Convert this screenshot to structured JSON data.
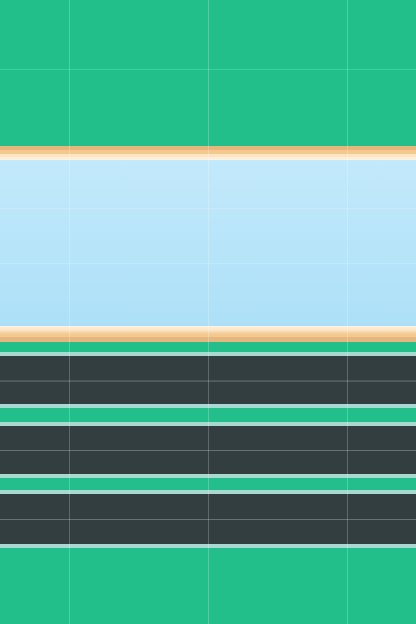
{
  "scene": {
    "name": "crossy-terrain-board",
    "colors": {
      "grass": "#22bf8b",
      "water_top": "#c3e9fb",
      "water_bottom": "#ade0f8",
      "sand_dark": "#e7b67c",
      "sand_mid": "#f4c98f",
      "sand_light": "#ffe4c4",
      "foam": "#fff1de",
      "road": "#333e40",
      "road_edge": "#a9d8d2",
      "grid_line": "#ffffff"
    },
    "terrain_rows": [
      "grass",
      "shore",
      "water",
      "shore",
      "grass",
      "road",
      "grass",
      "road",
      "grass",
      "road",
      "grass"
    ]
  }
}
